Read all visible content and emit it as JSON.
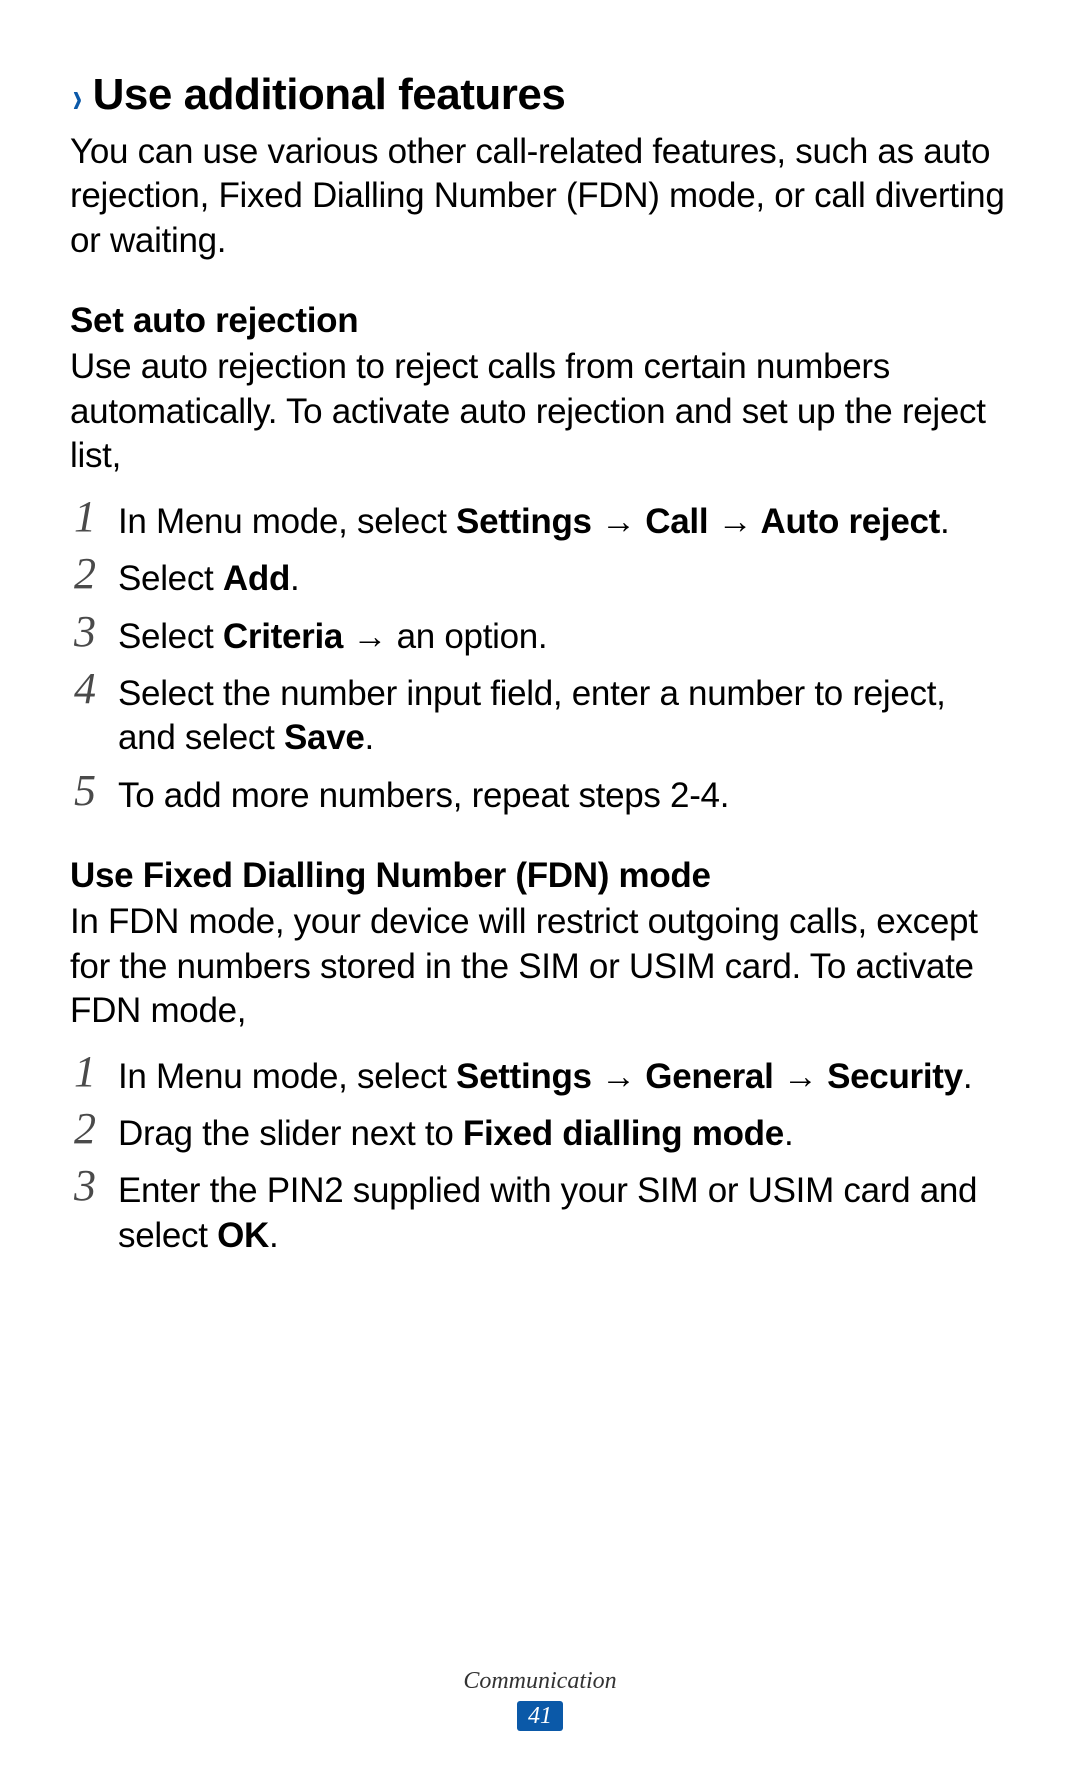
{
  "section": {
    "chevron": "›",
    "title": "Use additional features",
    "intro": "You can use various other call-related features, such as auto rejection, Fixed Dialling Number (FDN) mode, or call diverting or waiting."
  },
  "sub1": {
    "heading": "Set auto rejection",
    "desc": "Use auto rejection to reject calls from certain numbers automatically. To activate auto rejection and set up the reject list,",
    "steps": {
      "n1": "1",
      "n2": "2",
      "n3": "3",
      "n4": "4",
      "n5": "5",
      "s1a": "In Menu mode, select ",
      "s1b": "Settings",
      "s1arrow1": " → ",
      "s1c": "Call",
      "s1arrow2": " → ",
      "s1d": "Auto reject",
      "s1e": ".",
      "s2a": "Select ",
      "s2b": "Add",
      "s2c": ".",
      "s3a": "Select ",
      "s3b": "Criteria",
      "s3c": " → an option.",
      "s4a": "Select the number input field, enter a number to reject, and select ",
      "s4b": "Save",
      "s4c": ".",
      "s5": "To add more numbers, repeat steps 2-4."
    }
  },
  "sub2": {
    "heading": "Use Fixed Dialling Number (FDN) mode",
    "desc": "In FDN mode, your device will restrict outgoing calls, except for the numbers stored in the SIM or USIM card. To activate FDN mode,",
    "steps": {
      "n1": "1",
      "n2": "2",
      "n3": "3",
      "s1a": "In Menu mode, select ",
      "s1b": "Settings",
      "s1arrow1": " → ",
      "s1c": "General",
      "s1arrow2": " → ",
      "s1d": "Security",
      "s1e": ".",
      "s2a": "Drag the slider next to ",
      "s2b": "Fixed dialling mode",
      "s2c": ".",
      "s3a": "Enter the PIN2 supplied with your SIM or USIM card and select ",
      "s3b": "OK",
      "s3c": "."
    }
  },
  "footer": {
    "label": "Communication",
    "page": "41"
  }
}
